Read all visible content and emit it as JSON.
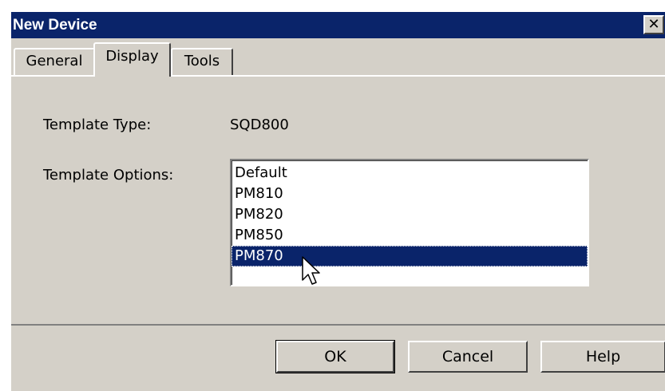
{
  "window": {
    "title": "New Device",
    "close_glyph": "✕"
  },
  "tabs": [
    {
      "label": "General",
      "active": false
    },
    {
      "label": "Display",
      "active": true
    },
    {
      "label": "Tools",
      "active": false
    }
  ],
  "form": {
    "template_type_label": "Template Type:",
    "template_type_value": "SQD800",
    "template_options_label": "Template Options:",
    "options": [
      "Default",
      "PM810",
      "PM820",
      "PM850",
      "PM870"
    ],
    "selected_option": "PM870"
  },
  "buttons": {
    "ok": "OK",
    "cancel": "Cancel",
    "help": "Help"
  },
  "colors": {
    "title_bar": "#0a246a",
    "selection": "#0a246a",
    "face": "#d4d0c8"
  }
}
